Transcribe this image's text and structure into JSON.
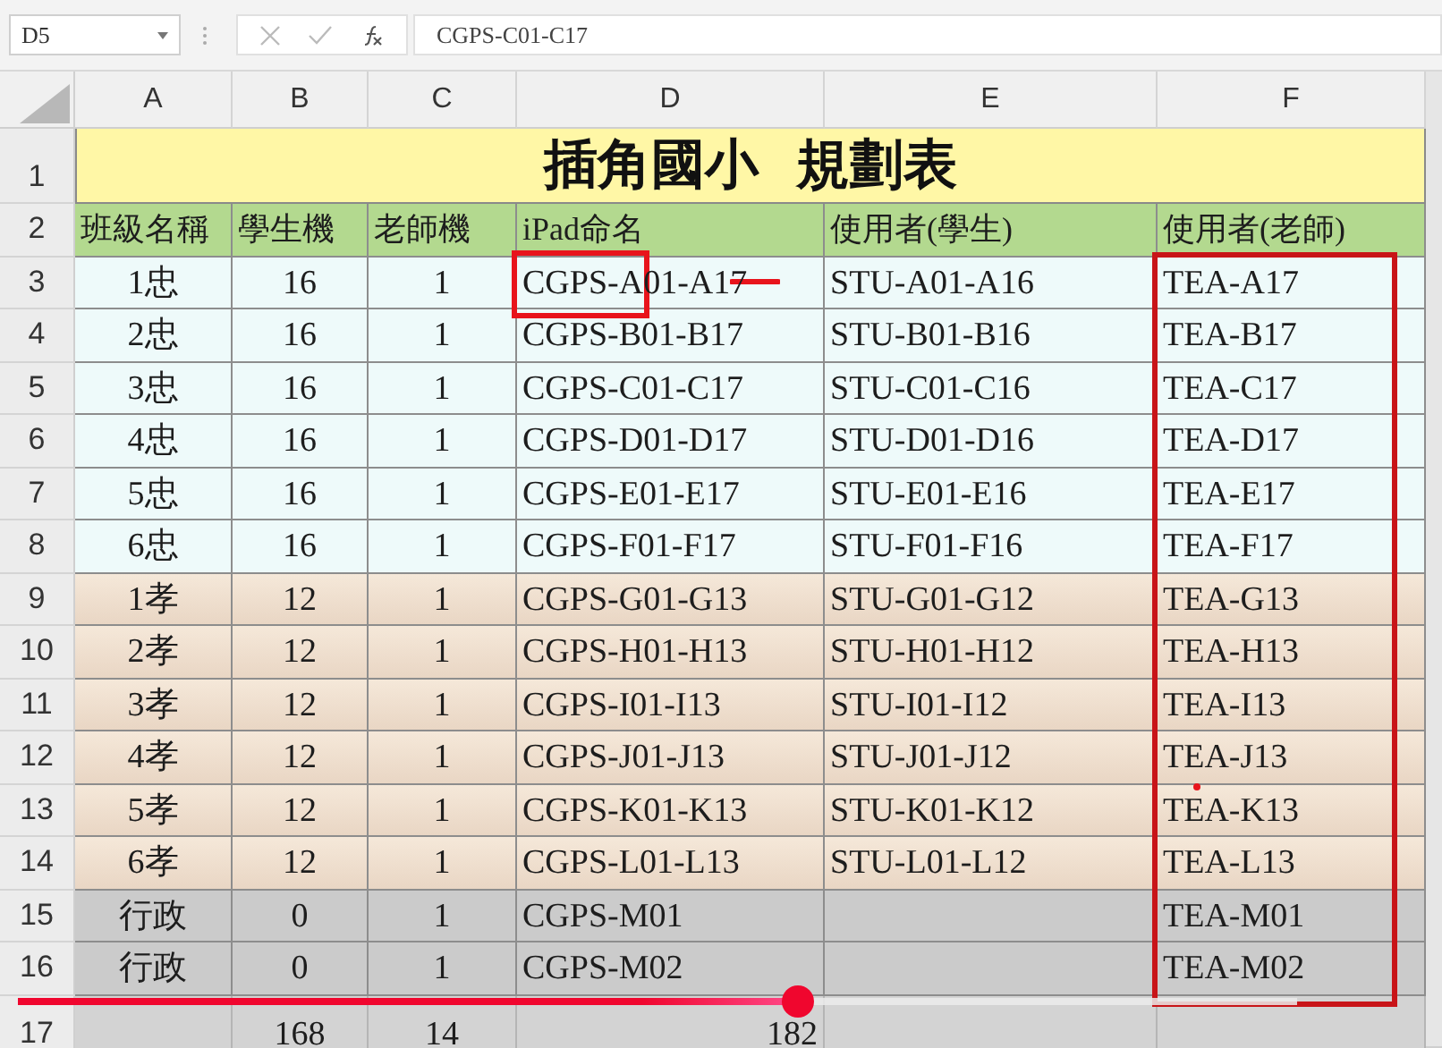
{
  "name_box": "D5",
  "formula": "CGPS-C01-C17",
  "columns": [
    "A",
    "B",
    "C",
    "D",
    "E",
    "F"
  ],
  "title_row": {
    "number": "1",
    "title": "插角國小  規劃表"
  },
  "rows": [
    {
      "number": "2",
      "kind": "header",
      "cells": {
        "A": "班級名稱",
        "B": "學生機",
        "C": "老師機",
        "D": "iPad命名",
        "E": "使用者(學生)",
        "F": "使用者(老師)"
      }
    },
    {
      "number": "3",
      "kind": "class",
      "cells": {
        "A": "1忠",
        "B": "16",
        "C": "1",
        "D": "CGPS-A01-A17",
        "E": "STU-A01-A16",
        "F": "TEA-A17"
      }
    },
    {
      "number": "4",
      "kind": "class",
      "cells": {
        "A": "2忠",
        "B": "16",
        "C": "1",
        "D": "CGPS-B01-B17",
        "E": "STU-B01-B16",
        "F": "TEA-B17"
      }
    },
    {
      "number": "5",
      "kind": "class",
      "cells": {
        "A": "3忠",
        "B": "16",
        "C": "1",
        "D": "CGPS-C01-C17",
        "E": "STU-C01-C16",
        "F": "TEA-C17"
      }
    },
    {
      "number": "6",
      "kind": "class",
      "cells": {
        "A": "4忠",
        "B": "16",
        "C": "1",
        "D": "CGPS-D01-D17",
        "E": "STU-D01-D16",
        "F": "TEA-D17"
      }
    },
    {
      "number": "7",
      "kind": "class",
      "cells": {
        "A": "5忠",
        "B": "16",
        "C": "1",
        "D": "CGPS-E01-E17",
        "E": "STU-E01-E16",
        "F": "TEA-E17"
      }
    },
    {
      "number": "8",
      "kind": "class",
      "cells": {
        "A": "6忠",
        "B": "16",
        "C": "1",
        "D": "CGPS-F01-F17",
        "E": "STU-F01-F16",
        "F": "TEA-F17"
      }
    },
    {
      "number": "9",
      "kind": "class-b",
      "cells": {
        "A": "1孝",
        "B": "12",
        "C": "1",
        "D": "CGPS-G01-G13",
        "E": "STU-G01-G12",
        "F": "TEA-G13"
      }
    },
    {
      "number": "10",
      "kind": "class-b",
      "cells": {
        "A": "2孝",
        "B": "12",
        "C": "1",
        "D": "CGPS-H01-H13",
        "E": "STU-H01-H12",
        "F": "TEA-H13"
      }
    },
    {
      "number": "11",
      "kind": "class-b",
      "cells": {
        "A": "3孝",
        "B": "12",
        "C": "1",
        "D": "CGPS-I01-I13",
        "E": "STU-I01-I12",
        "F": "TEA-I13"
      }
    },
    {
      "number": "12",
      "kind": "class-b",
      "cells": {
        "A": "4孝",
        "B": "12",
        "C": "1",
        "D": "CGPS-J01-J13",
        "E": "STU-J01-J12",
        "F": "TEA-J13"
      }
    },
    {
      "number": "13",
      "kind": "class-b",
      "cells": {
        "A": "5孝",
        "B": "12",
        "C": "1",
        "D": "CGPS-K01-K13",
        "E": "STU-K01-K12",
        "F": "TEA-K13"
      }
    },
    {
      "number": "14",
      "kind": "class-b",
      "cells": {
        "A": "6孝",
        "B": "12",
        "C": "1",
        "D": "CGPS-L01-L13",
        "E": "STU-L01-L12",
        "F": "TEA-L13"
      }
    },
    {
      "number": "15",
      "kind": "admin",
      "cells": {
        "A": "行政",
        "B": "0",
        "C": "1",
        "D": "CGPS-M01",
        "F": "TEA-M01"
      }
    },
    {
      "number": "16",
      "kind": "admin",
      "cells": {
        "A": "行政",
        "B": "0",
        "C": "1",
        "D": "CGPS-M02",
        "F": "TEA-M02"
      }
    },
    {
      "number": "17",
      "kind": "total",
      "cells": {
        "B": "168",
        "C": "14",
        "D": "182"
      }
    }
  ],
  "video_progress": {
    "level": 0.61
  }
}
